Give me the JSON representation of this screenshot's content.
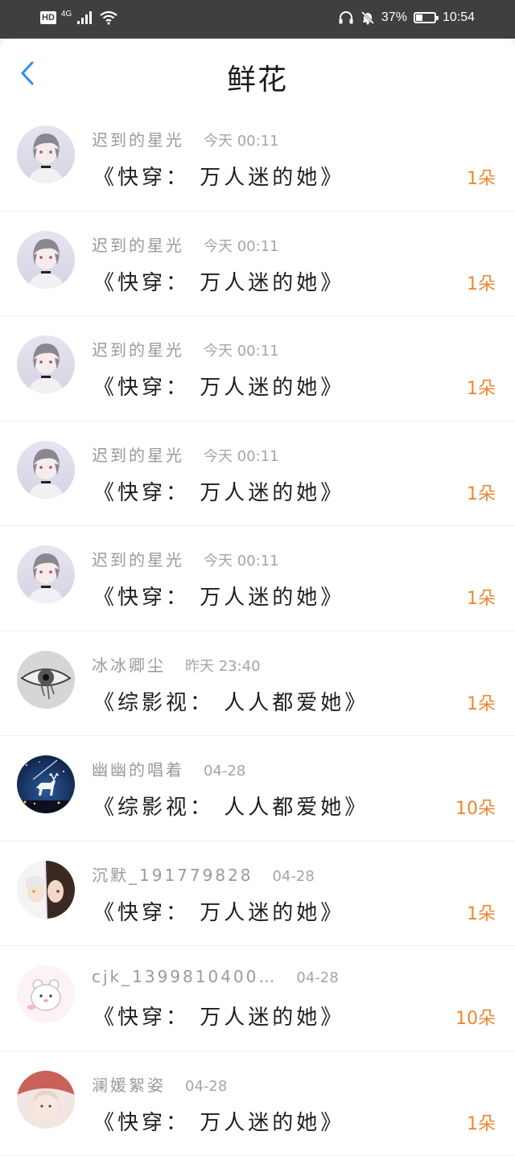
{
  "status_bar": {
    "hd": "HD",
    "network": "4G",
    "battery": "37%",
    "battery_level": 0.37,
    "time": "10:54"
  },
  "header": {
    "title": "鲜花"
  },
  "records": [
    {
      "user": "迟到的星光",
      "time": "今天 00:11",
      "book": "《快穿： 万人迷的她》",
      "count": "1朵",
      "avatar": "gray-hair-boy"
    },
    {
      "user": "迟到的星光",
      "time": "今天 00:11",
      "book": "《快穿： 万人迷的她》",
      "count": "1朵",
      "avatar": "gray-hair-boy"
    },
    {
      "user": "迟到的星光",
      "time": "今天 00:11",
      "book": "《快穿： 万人迷的她》",
      "count": "1朵",
      "avatar": "gray-hair-boy"
    },
    {
      "user": "迟到的星光",
      "time": "今天 00:11",
      "book": "《快穿： 万人迷的她》",
      "count": "1朵",
      "avatar": "gray-hair-boy"
    },
    {
      "user": "迟到的星光",
      "time": "今天 00:11",
      "book": "《快穿： 万人迷的她》",
      "count": "1朵",
      "avatar": "gray-hair-boy"
    },
    {
      "user": "冰冰卿尘",
      "time": "昨天 23:40",
      "book": "《综影视： 人人都爱她》",
      "count": "1朵",
      "avatar": "eye-sketch"
    },
    {
      "user": "幽幽的唱着",
      "time": "04-28",
      "book": "《综影视： 人人都爱她》",
      "count": "10朵",
      "avatar": "night-deer"
    },
    {
      "user": "沉默_191779828",
      "time": "04-28",
      "book": "《快穿： 万人迷的她》",
      "count": "1朵",
      "avatar": "anime-pair"
    },
    {
      "user": "cjk_1399810400…",
      "time": "04-28",
      "book": "《快穿： 万人迷的她》",
      "count": "10朵",
      "avatar": "cute-bear"
    },
    {
      "user": "澜媛絮姿",
      "time": "04-28",
      "book": "《快穿： 万人迷的她》",
      "count": "1朵",
      "avatar": "red-anime-girl"
    }
  ],
  "colors": {
    "accent": "#f0862e",
    "back_arrow": "#2f8cf5",
    "status_bar": "#3f3f3f"
  }
}
